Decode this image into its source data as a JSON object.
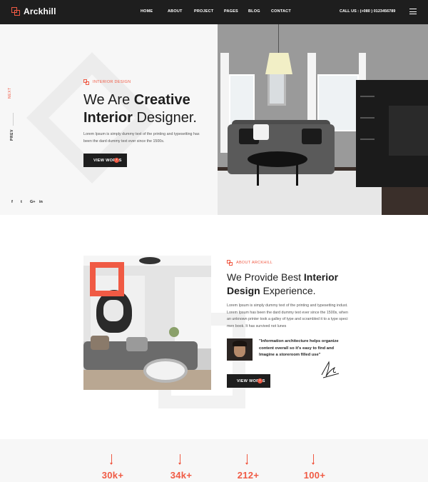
{
  "navbar": {
    "brand": "Arckhill",
    "links": [
      "HOME",
      "ABOUT",
      "PROJECT",
      "PAGES",
      "BLOG",
      "CONTACT"
    ],
    "call": "CALL US : (+080 ) 0123456789"
  },
  "hero": {
    "subtitle": "INTERIOR DESIGN",
    "title_line1_a": "We Are ",
    "title_line1_b": "Creative",
    "title_line2_a": "Interior",
    "title_line2_b": " Designer.",
    "description": "Lorem Ipsum is simply dummy text of the printing and typesetting has been the dard dummy text ever since the 1500s.",
    "button": "VIEW WORKS",
    "next": "NEXT",
    "prev": "PREV",
    "socials": [
      "f",
      "t",
      "G+",
      "in"
    ]
  },
  "about": {
    "subtitle": "ABOUT ARCKHILL",
    "title_line1_a": "We Provide Best ",
    "title_line1_b": "Interior",
    "title_line2_a": "Design",
    "title_line2_b": " Experience.",
    "description": "Lorem Ipsum is simply dummy text of the printing and typesetting indust. Lorem Ipsum has been the dard dummy text ever since the 1500s, when an unknown printer took a galley of type and scrambled it to a type speci men book. It has survived not lunes",
    "quote": "\"Information architecture helps organize content overall so it's easy to find and Imagine a storeroom filled use\"",
    "button": "VIEW WORKS"
  },
  "stats": {
    "items": [
      "30k+",
      "34k+",
      "212+",
      "100+"
    ]
  },
  "colors": {
    "accent": "#f05a44",
    "dark": "#1e1e1e",
    "light_bg": "#f7f7f7"
  }
}
